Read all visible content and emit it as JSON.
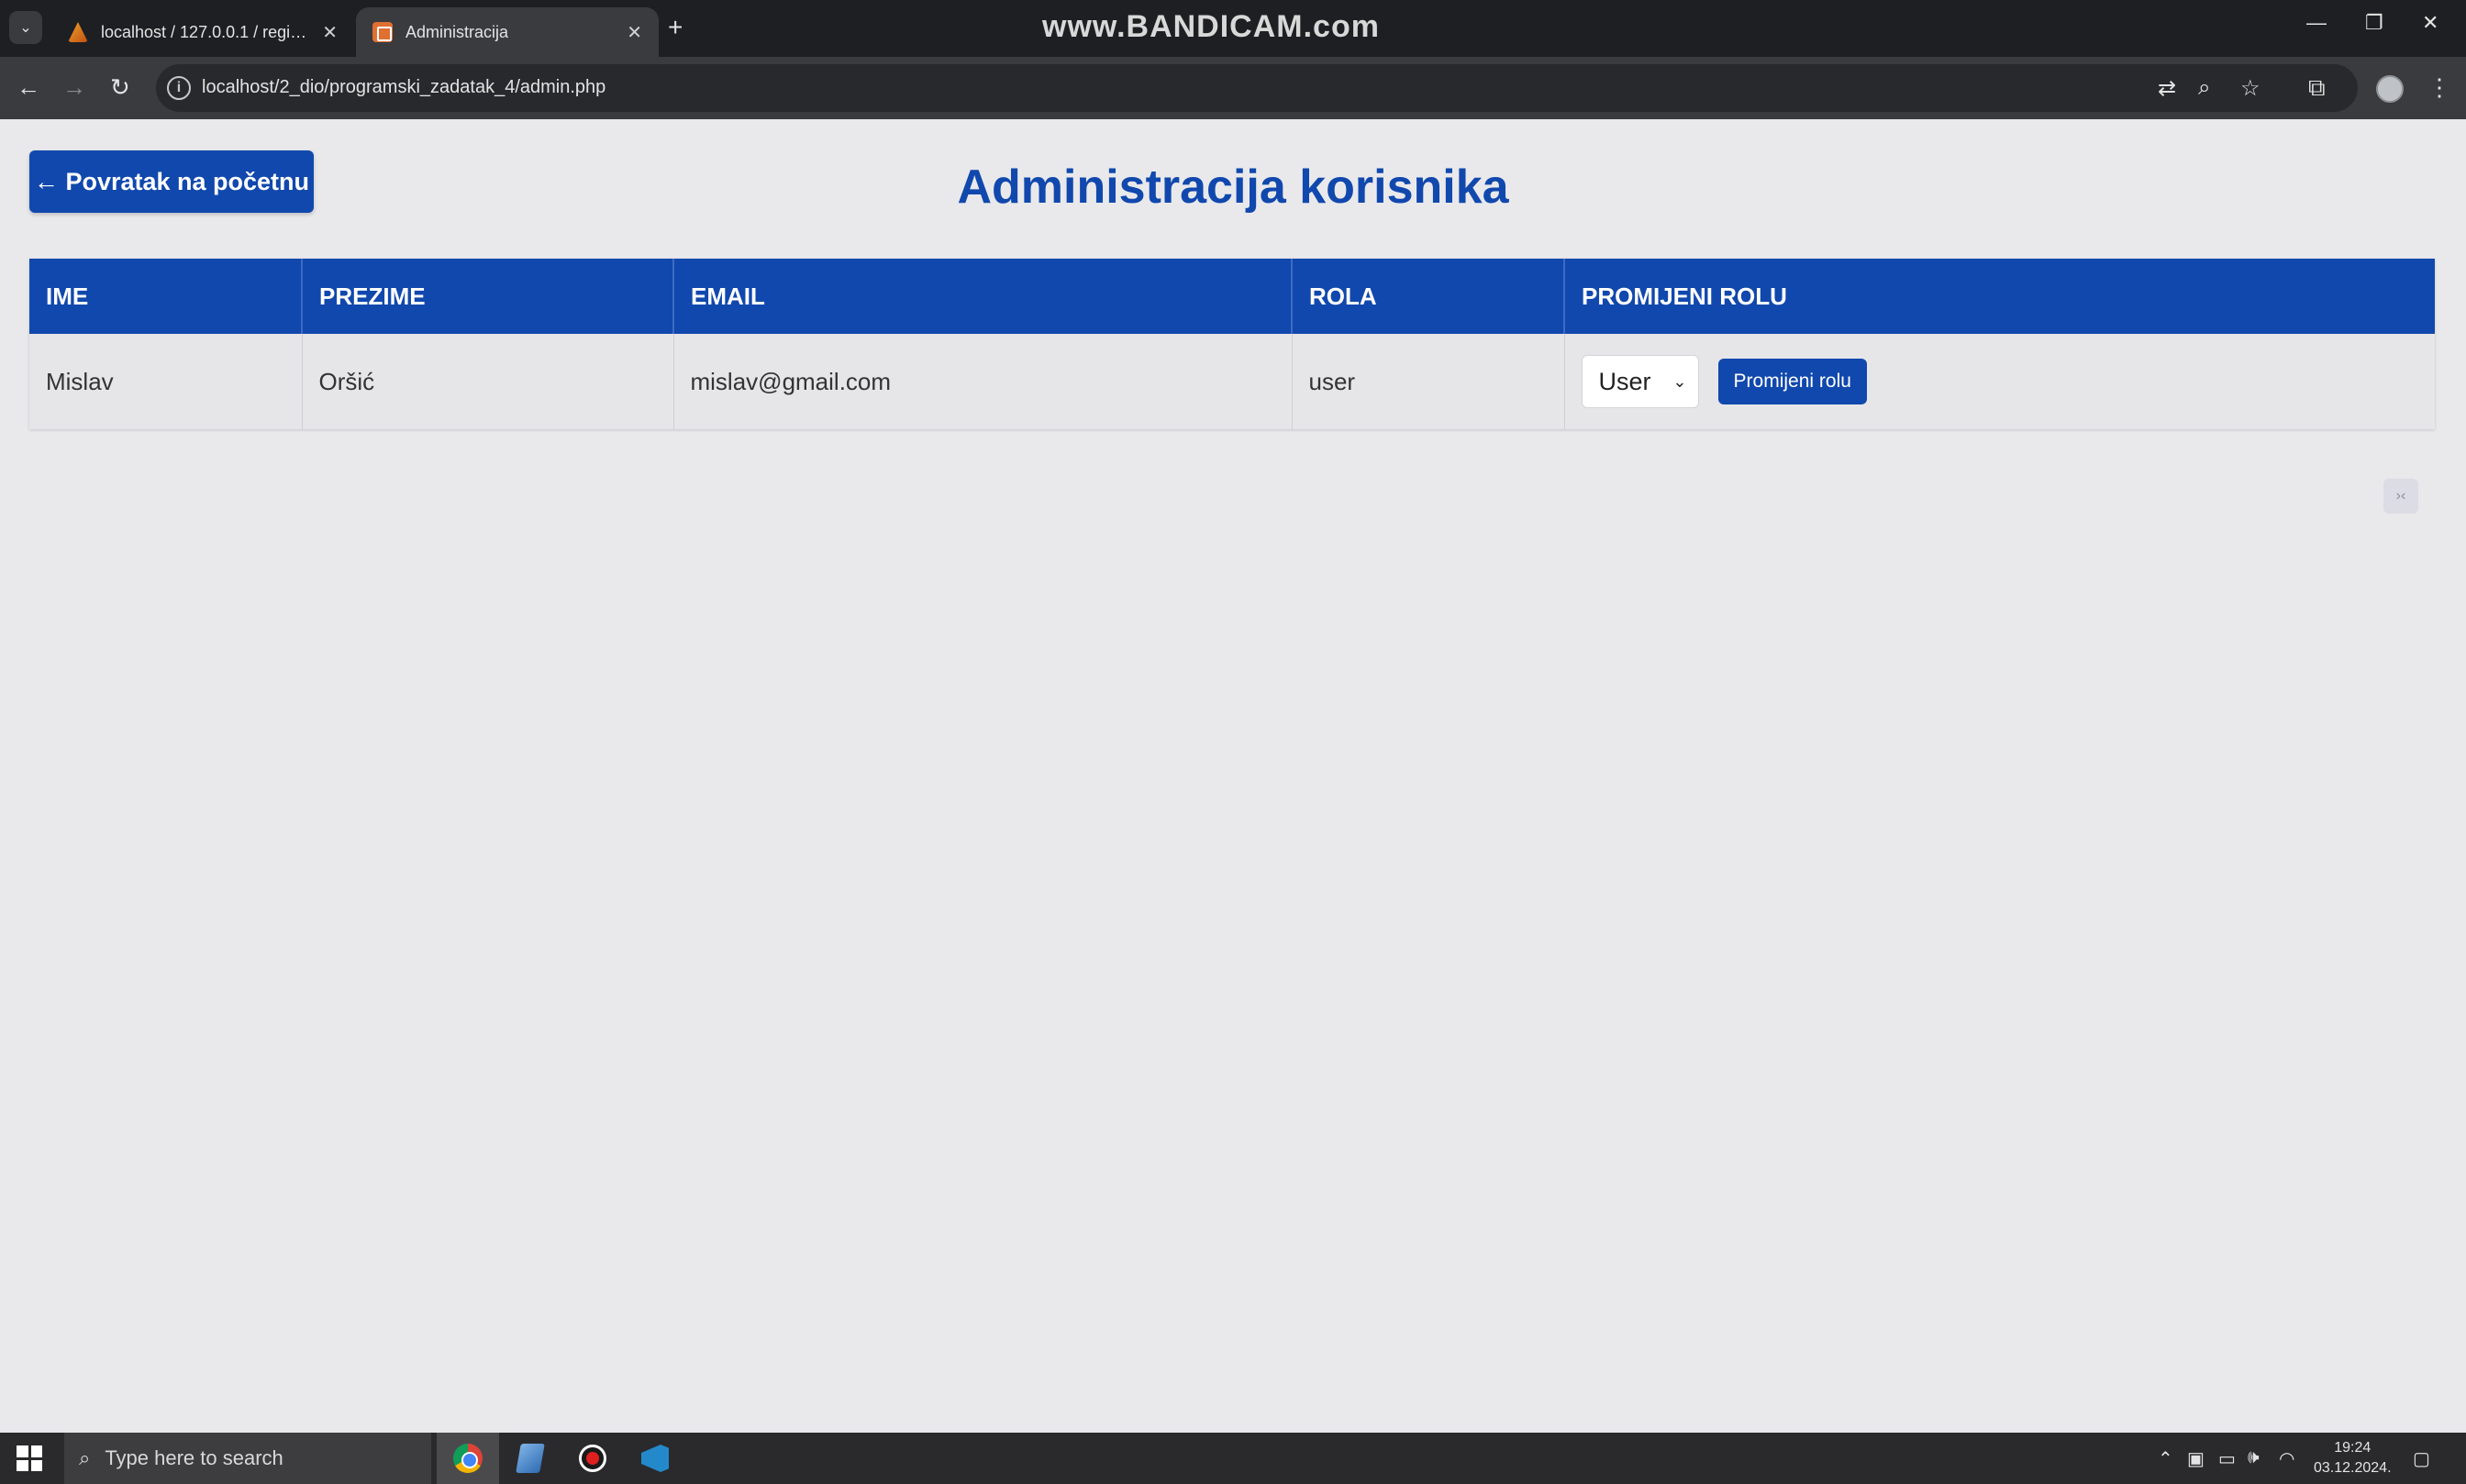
{
  "browser": {
    "watermark": "www.BANDICAM.com",
    "tabs": [
      {
        "title": "localhost / 127.0.0.1 / registrac",
        "active": false,
        "favicon": "phpmyadmin-icon"
      },
      {
        "title": "Administracija",
        "active": true,
        "favicon": "page-icon"
      }
    ],
    "url": "localhost/2_dio/programski_zadatak_4/admin.php"
  },
  "page": {
    "back_label": "← Povratak na početnu",
    "title": "Administracija korisnika",
    "table": {
      "headers": [
        "IME",
        "PREZIME",
        "EMAIL",
        "ROLA",
        "PROMIJENI ROLU"
      ],
      "rows": [
        {
          "ime": "Mislav",
          "prezime": "Oršić",
          "email": "mislav@gmail.com",
          "rola": "user",
          "select_value": "User",
          "button_label": "Promijeni rolu"
        }
      ]
    }
  },
  "taskbar": {
    "search_placeholder": "Type here to search",
    "time": "19:24",
    "date": "03.12.2024."
  },
  "colors": {
    "accent": "#1148ad",
    "page_bg": "#e9e9ec"
  }
}
